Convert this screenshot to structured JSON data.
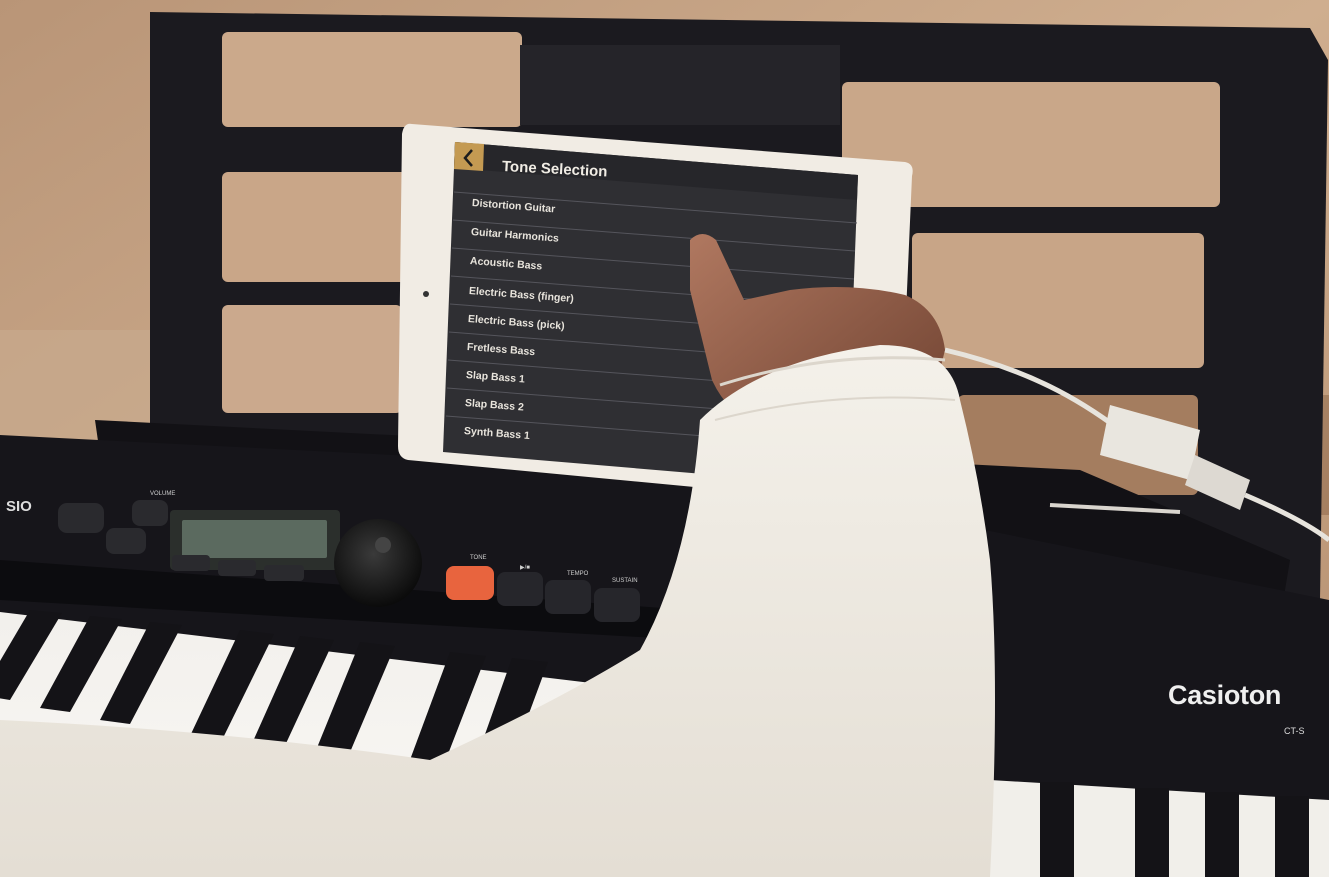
{
  "screen": {
    "title": "Tone Selection",
    "back_icon": "chevron-left-icon",
    "tones": [
      "Distortion Guitar",
      "Guitar Harmonics",
      "Acoustic Bass",
      "Electric Bass (finger)",
      "Electric Bass (pick)",
      "Fretless Bass",
      "Slap Bass 1",
      "Slap Bass 2",
      "Synth Bass 1"
    ]
  },
  "keyboard": {
    "brand": "Casioton",
    "model": "CT-S",
    "brand_left": "SIO",
    "labels": {
      "volume": "VOLUME",
      "tone": "TONE",
      "play": "▶/■",
      "tempo": "TEMPO",
      "sustain": "SUSTAIN"
    }
  },
  "colors": {
    "screen_bg": "#2f2f33",
    "back_button": "#c49a52",
    "tone_button": "#e8643e",
    "sweater": "#efeae2",
    "wood": "#c7a484"
  }
}
